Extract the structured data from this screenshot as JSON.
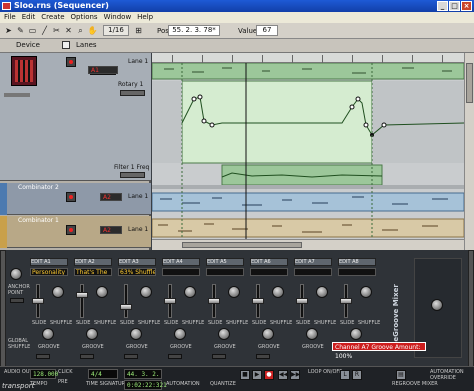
{
  "window": {
    "title": "Sloo.rns (Sequencer)"
  },
  "menu": [
    "File",
    "Edit",
    "Create",
    "Options",
    "Window",
    "Help"
  ],
  "toolbar": {
    "quantize": "1/16",
    "pos_label": "Pos:",
    "pos_value": "55. 2. 3. 78*",
    "value_label": "Value",
    "value_value": "67"
  },
  "lanebar": {
    "device_label": "Device",
    "lanes_label": "Lanes"
  },
  "tracks": {
    "lane1_label": "Lane 1",
    "rotary_label": "Rotary 1",
    "filter_label": "Filter 1 Freq",
    "combinator2": "Combinator 2",
    "combinator2_lane": "Lane 1",
    "combinator2_slot": "A2",
    "combinator1": "Combinator 1",
    "combinator1_lane": "Lane 1",
    "combinator1_slot": "A2",
    "slot_a1": "A1"
  },
  "mixer": {
    "channels": [
      {
        "slot": "A1",
        "name": "Personality"
      },
      {
        "slot": "A2",
        "name": "That's The"
      },
      {
        "slot": "A3",
        "name": "63% Shuffle"
      },
      {
        "slot": "A4",
        "name": ""
      },
      {
        "slot": "A5",
        "name": ""
      },
      {
        "slot": "A6",
        "name": ""
      },
      {
        "slot": "A7",
        "name": ""
      },
      {
        "slot": "A8",
        "name": ""
      }
    ],
    "edit_label": "EDIT",
    "slide_label": "SLIDE",
    "shuffle_label": "SHUFFLE",
    "groove_label": "GROOVE",
    "global_shuffle_label": "GLOBAL SHUFFLE",
    "anchor_label": "ANCHOR POINT",
    "logo_text": "ReGroove Mixer",
    "tooltip": "Channel A7 Groove Amount: 100%"
  },
  "transport": {
    "tempo": "128.000",
    "position": "44. 3. 2. 153",
    "time": "0:02:22:321",
    "signature": "4/4",
    "label": "transport",
    "audio_out": "AUDIO OUT",
    "click": "CLICK",
    "pre": "PRE",
    "time_sig_label": "TIME SIGNATURE",
    "tempo_label": "TEMPO",
    "automation_label": "AUTOMATION",
    "quantize_label": "QUANTIZE",
    "loop_label": "LOOP ON/OFF",
    "regroove_label": "REGROOVE MIXER",
    "auto_ovr": "AUTOMATION OVERRIDE"
  },
  "colors": {
    "title_bar": "#1e5ad6",
    "clip_green": "#b9dcb0",
    "clip_blue": "#a6c2d8",
    "clip_tan": "#d8c9a6",
    "tooltip": "#cc1d1d"
  }
}
